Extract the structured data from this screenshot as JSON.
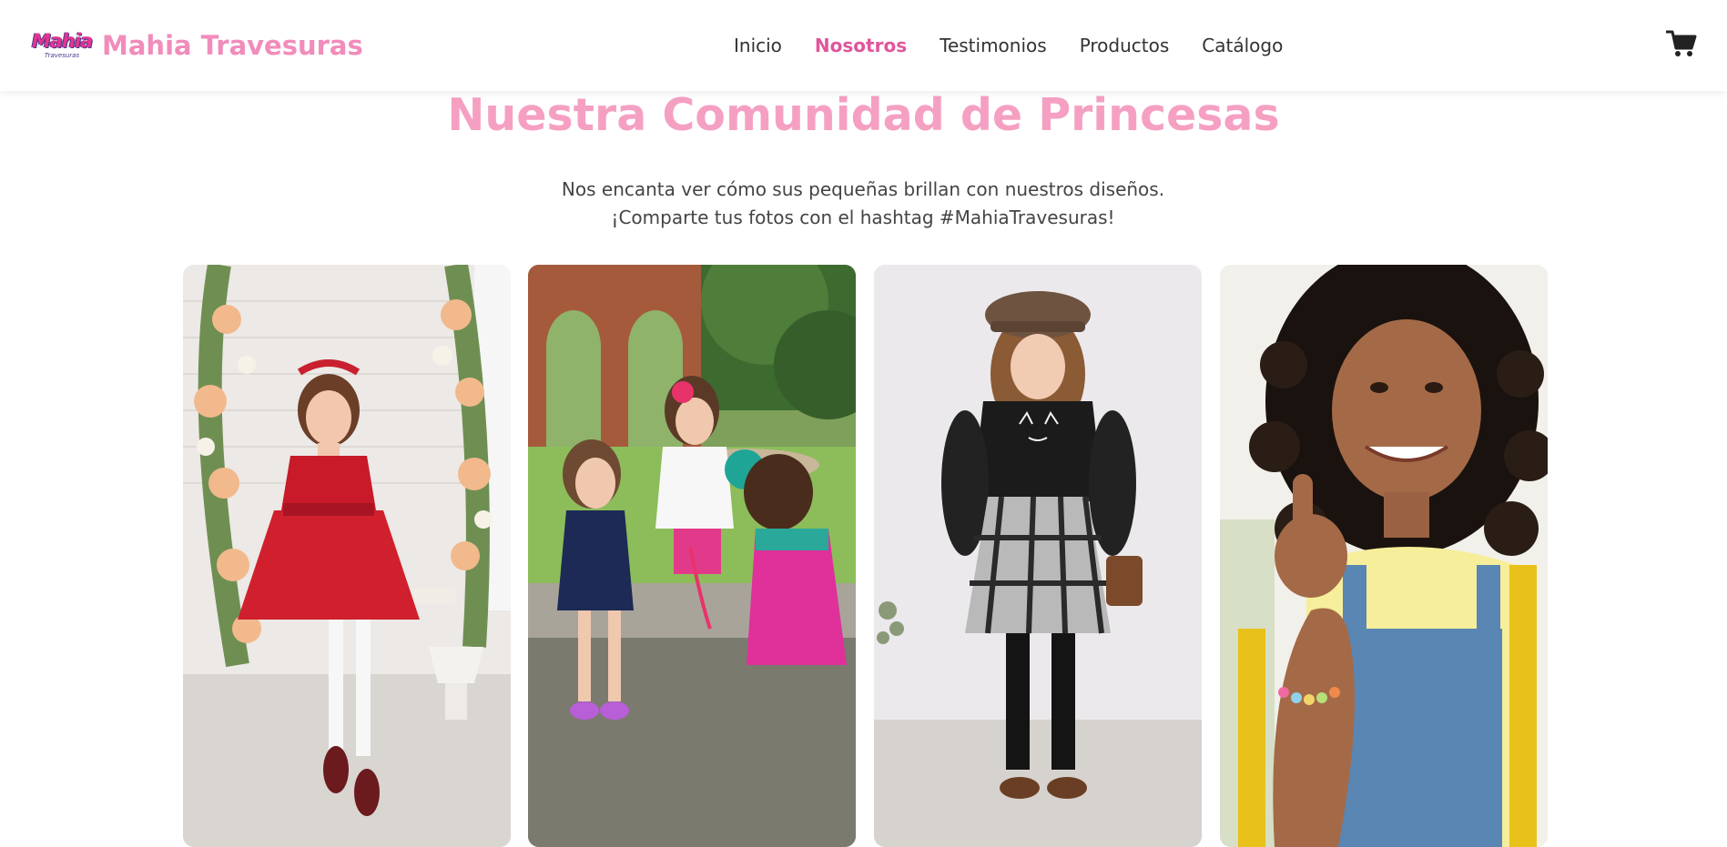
{
  "brand": {
    "logo_text": "Mahia",
    "logo_subtext": "Travesuras",
    "name": "Mahia Travesuras"
  },
  "nav": {
    "items": [
      {
        "label": "Inicio",
        "active": false
      },
      {
        "label": "Nosotros",
        "active": true
      },
      {
        "label": "Testimonios",
        "active": false
      },
      {
        "label": "Productos",
        "active": false
      },
      {
        "label": "Catálogo",
        "active": false
      }
    ]
  },
  "cart": {
    "icon": "shopping-cart-icon"
  },
  "community": {
    "title": "Nuestra Comunidad de Princesas",
    "subtitle_line1": "Nos encanta ver cómo sus pequeñas brillan con nuestros diseños.",
    "subtitle_line2": "¡Comparte tus fotos con el hashtag #MahiaTravesuras!"
  },
  "gallery": {
    "photos": [
      {
        "name": "gallery-photo-red-sequin-dress"
      },
      {
        "name": "gallery-photo-girls-in-park"
      },
      {
        "name": "gallery-photo-plaid-skirt-beret"
      },
      {
        "name": "gallery-photo-girl-thumbs-up"
      }
    ]
  },
  "colors": {
    "brand_pink": "#f18cbb",
    "nav_active": "#e0559c",
    "title_pink": "#f5a0c2",
    "text": "#333333"
  }
}
